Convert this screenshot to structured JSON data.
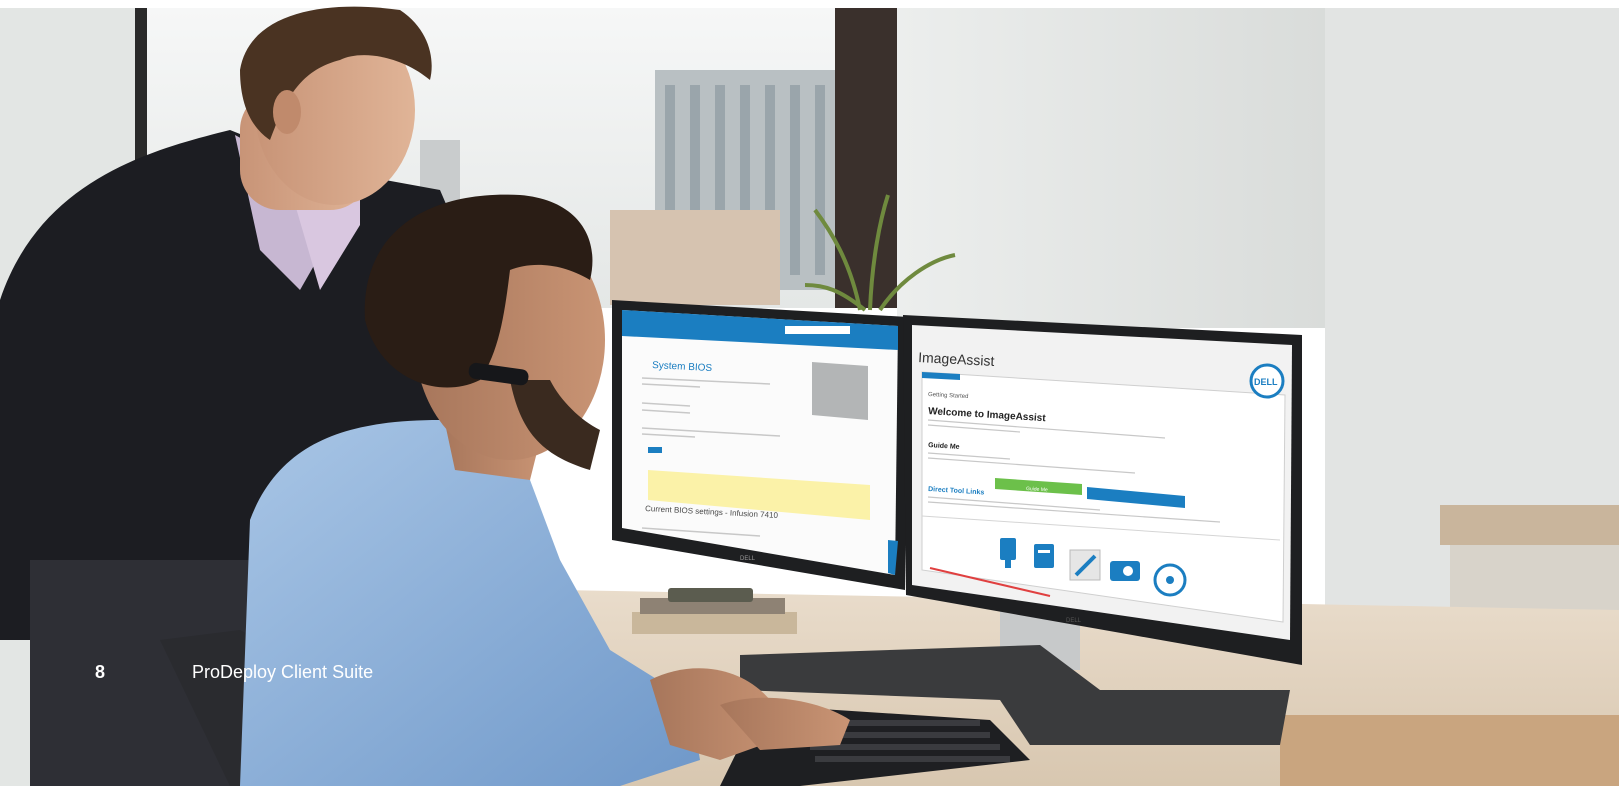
{
  "footer": {
    "page_number": "8",
    "title": "ProDeploy Client Suite"
  },
  "right_monitor": {
    "window_title": "ImageAssist",
    "tab": "Getting Started",
    "welcome_heading": "Welcome to ImageAssist",
    "guide_heading": "Guide Me",
    "direct_link_heading": "Direct Tool Links",
    "guide_button": "Guide Me",
    "brand": "DELL"
  },
  "left_monitor": {
    "page_heading": "System BIOS",
    "section_heading": "Current BIOS settings - Infusion 7410"
  },
  "colors": {
    "dell_blue": "#1b7ec1",
    "guide_green": "#6cc04a"
  },
  "icons": [
    "usb-icon",
    "copy-icon",
    "pencil-icon",
    "camera-icon",
    "disc-icon"
  ]
}
